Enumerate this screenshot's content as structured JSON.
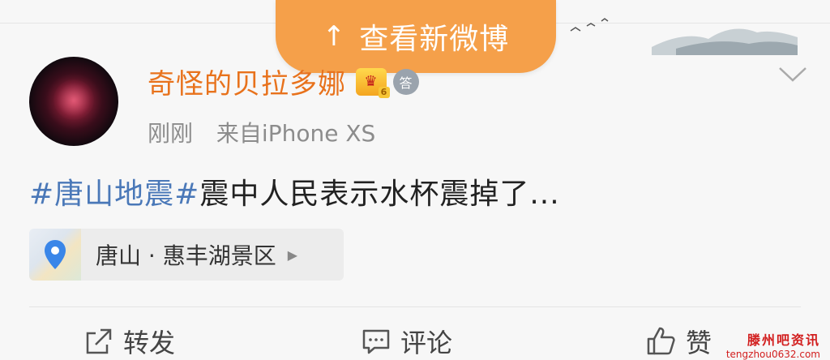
{
  "banner": {
    "arrow": "↑",
    "label": "查看新微博"
  },
  "post": {
    "author": "奇怪的贝拉多娜",
    "answer_badge": "答",
    "time": "刚刚",
    "source": "来自iPhone XS",
    "topic": "#唐山地震#",
    "text": "震中人民表示水杯震掉了...",
    "location": "唐山 · 惠丰湖景区"
  },
  "actions": {
    "repost": "转发",
    "comment": "评论",
    "like": "赞"
  },
  "watermark": {
    "name": "滕州吧资讯",
    "url": "tengzhou0632.com"
  },
  "colors": {
    "accent": "#f5a04a",
    "username": "#e8721c",
    "topic": "#4a78b8"
  }
}
